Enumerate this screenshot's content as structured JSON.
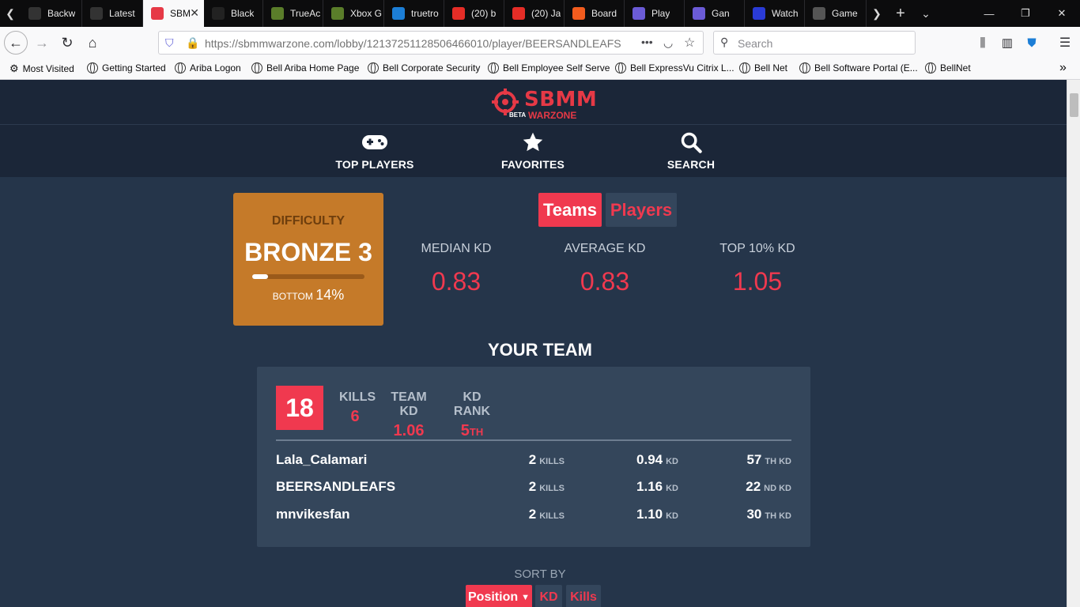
{
  "browser": {
    "tabs": [
      {
        "title": "Backw",
        "fav_color": "#333"
      },
      {
        "title": "Latest",
        "fav_color": "#333"
      },
      {
        "title": "SBM",
        "fav_color": "#e63946"
      },
      {
        "title": "Black",
        "fav_color": "#222"
      },
      {
        "title": "TrueAc",
        "fav_color": "#5a7d2a"
      },
      {
        "title": "Xbox G",
        "fav_color": "#5a7d2a"
      },
      {
        "title": "truetro",
        "fav_color": "#1c7ed6"
      },
      {
        "title": "(20) b",
        "fav_color": "#e52d27"
      },
      {
        "title": "(20) Ja",
        "fav_color": "#e52d27"
      },
      {
        "title": "Board",
        "fav_color": "#f25c1e"
      },
      {
        "title": "Play",
        "fav_color": "#6b5bd6"
      },
      {
        "title": "Gan",
        "fav_color": "#6b5bd6"
      },
      {
        "title": "Watch",
        "fav_color": "#2a3bd6"
      },
      {
        "title": "Game",
        "fav_color": "#555"
      }
    ],
    "url": "https://sbmmwarzone.com/lobby/12137251128506466010/player/BEERSANDLEAFS",
    "url_menu": "•••",
    "search_placeholder": "Search",
    "bookmarks": [
      "Most Visited",
      "Getting Started",
      "Ariba Logon",
      "Bell Ariba Home Page",
      "Bell Corporate Security",
      "Bell Employee Self Serve",
      "Bell ExpressVu Citrix L...",
      "Bell Net",
      "Bell Software Portal (E...",
      "BellNet"
    ]
  },
  "site": {
    "logo_text": "SBMM",
    "logo_sub": "WARZONE",
    "logo_beta": "BETA",
    "nav": {
      "top_players": "TOP PLAYERS",
      "favorites": "FAVORITES",
      "search": "SEARCH"
    },
    "difficulty": {
      "label": "DIFFICULTY",
      "rank": "BRONZE 3",
      "bottom_label": "BOTTOM",
      "bottom_pct": "14%",
      "fill_fraction": 0.14
    },
    "toggle": {
      "teams": "Teams",
      "players": "Players"
    },
    "kd_stats": [
      {
        "label": "MEDIAN KD",
        "value": "0.83"
      },
      {
        "label": "AVERAGE KD",
        "value": "0.83"
      },
      {
        "label": "TOP 10% KD",
        "value": "1.05"
      }
    ],
    "your_team_title": "YOUR TEAM",
    "team": {
      "place": "18",
      "kills_label": "KILLS",
      "kills": "6",
      "team_kd_label": "TEAM KD",
      "team_kd": "1.06",
      "kd_rank_label": "KD RANK",
      "kd_rank": "5",
      "kd_rank_suffix": "TH",
      "players": [
        {
          "name": "Lala_Calamari",
          "kills": "2",
          "kills_unit": "KILLS",
          "kd": "0.94",
          "kd_unit": "KD",
          "rank": "57",
          "rank_unit": "TH KD"
        },
        {
          "name": "BEERSANDLEAFS",
          "kills": "2",
          "kills_unit": "KILLS",
          "kd": "1.16",
          "kd_unit": "KD",
          "rank": "22",
          "rank_unit": "ND KD"
        },
        {
          "name": "mnvikesfan",
          "kills": "2",
          "kills_unit": "KILLS",
          "kd": "1.10",
          "kd_unit": "KD",
          "rank": "30",
          "rank_unit": "TH KD"
        }
      ]
    },
    "sort": {
      "label": "SORT BY",
      "position": "Position",
      "kd": "KD",
      "kills": "Kills"
    }
  }
}
